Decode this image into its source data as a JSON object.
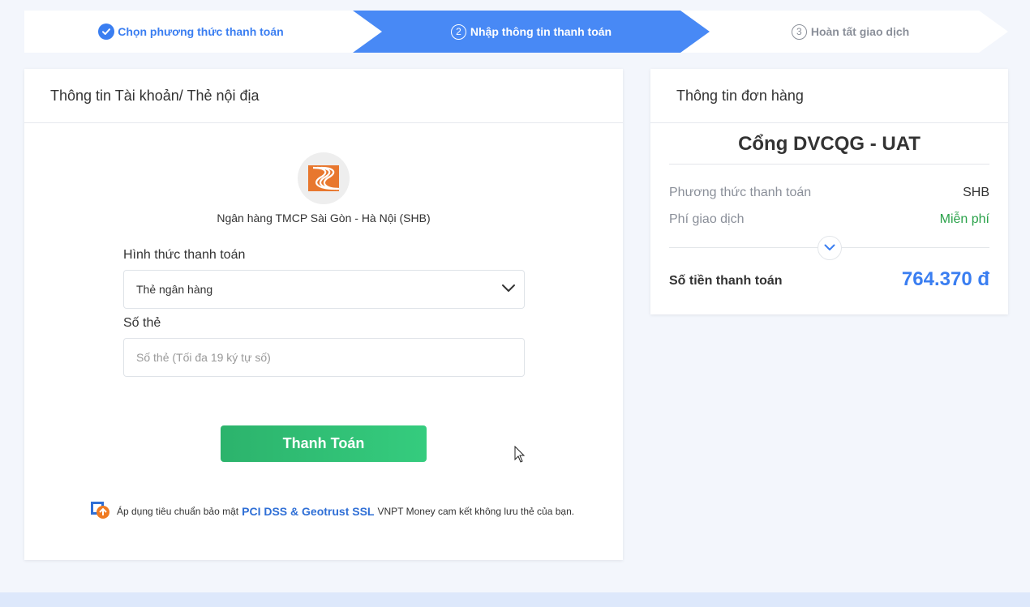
{
  "stepper": {
    "step1": {
      "label": "Chọn phương thức thanh toán",
      "state": "done"
    },
    "step2": {
      "number": "2",
      "label": "Nhập thông tin thanh toán",
      "state": "active"
    },
    "step3": {
      "number": "3",
      "label": "Hoàn tất giao dịch",
      "state": "pending"
    }
  },
  "account_panel": {
    "title": "Thông tin Tài khoản/ Thẻ nội địa",
    "bank_name": "Ngân hàng TMCP Sài Gòn - Hà Nội (SHB)",
    "bank_logo_icon": "shb-logo-icon",
    "payment_method_label": "Hình thức thanh toán",
    "payment_method_value": "Thẻ ngân hàng",
    "card_number_label": "Số thẻ",
    "card_number_placeholder": "Số thẻ (Tối đa 19 ký tự số)",
    "card_number_value": "",
    "pay_button_label": "Thanh Toán",
    "security_note": {
      "prefix": "Áp dụng tiêu chuẩn bảo mật",
      "highlight": "PCI DSS & Geotrust SSL",
      "suffix": "VNPT Money cam kết không lưu thẻ của bạn."
    }
  },
  "order_panel": {
    "title": "Thông tin đơn hàng",
    "merchant": "Cổng DVCQG - UAT",
    "rows": [
      {
        "label": "Phương thức thanh toán",
        "value": "SHB"
      },
      {
        "label": "Phí giao dịch",
        "value": "Miễn phí"
      }
    ],
    "total_label": "Số tiền thanh toán",
    "total_value": "764.370 đ"
  },
  "colors": {
    "accent": "#4889f5",
    "step_done": "#3a7ef1",
    "pay_button": "#2cb36c",
    "free_text": "#2aa24a",
    "total": "#3a7ef1",
    "bank_logo": "#e8772e"
  }
}
